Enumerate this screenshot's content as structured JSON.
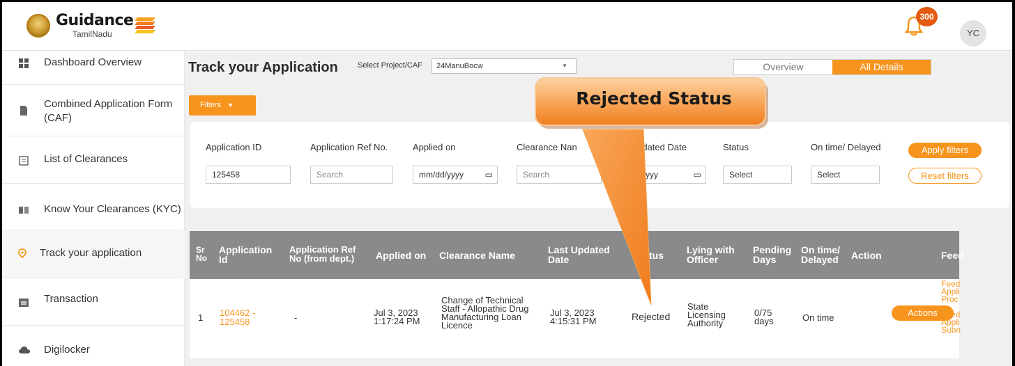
{
  "header": {
    "brand": "Guidance",
    "brand_sub": "TamilNadu",
    "notification_count": "300",
    "avatar_initials": "YC"
  },
  "sidebar": {
    "items": [
      {
        "label": "Dashboard Overview",
        "icon": "dashboard-icon"
      },
      {
        "label": "Combined Application Form (CAF)",
        "icon": "document-icon"
      },
      {
        "label": "List of Clearances",
        "icon": "list-icon"
      },
      {
        "label": "Know Your Clearances (KYC)",
        "icon": "book-icon"
      },
      {
        "label": "Track your application",
        "icon": "location-pin-icon"
      },
      {
        "label": "Transaction",
        "icon": "card-icon"
      },
      {
        "label": "Digilocker",
        "icon": "cloud-icon"
      }
    ]
  },
  "main": {
    "title": "Track your Application",
    "project_label": "Select Project/CAF",
    "project_value": "24ManuBocw",
    "tabs": [
      {
        "label": "Overview",
        "active": false
      },
      {
        "label": "All Details",
        "active": true
      }
    ],
    "filters_button": "Filters",
    "filters": {
      "application_id": {
        "label": "Application ID",
        "value": "125458"
      },
      "ref_no": {
        "label": "Application Ref No.",
        "placeholder": "Search"
      },
      "applied_on": {
        "label": "Applied on",
        "placeholder": "mm/dd/yyyy"
      },
      "clearance_name": {
        "label": "Clearance Nan",
        "placeholder": "Search"
      },
      "last_updated": {
        "label": "st Updated Date",
        "placeholder": "/dd/yyyy"
      },
      "status": {
        "label": "Status",
        "placeholder": "Select"
      },
      "on_time": {
        "label": "On time/ Delayed",
        "placeholder": "Select"
      }
    },
    "apply_filters": "Apply filters",
    "reset_filters": "Reset filters"
  },
  "table": {
    "headers": [
      "Sr No",
      "Application Id",
      "Application Ref No (from dept.)",
      "Applied on",
      "Clearance Name",
      "Last Updated Date",
      "tus",
      "Lying with Officer",
      "Pending Days",
      "On time/ Delayed",
      "Action",
      "Feed"
    ],
    "row": {
      "sr_no": "1",
      "app_id_1": "104462 -",
      "app_id_2": "125458",
      "ref_no": "-",
      "applied_date": "Jul 3, 2023",
      "applied_time": "1:17:24 PM",
      "clearance_1": "Change of Technical",
      "clearance_2": "Staff - Allopathic Drug",
      "clearance_3": "Manufacturing Loan",
      "clearance_4": "Licence",
      "updated_date": "Jul 3, 2023",
      "updated_time": "4:15:31 PM",
      "status": "Rejected",
      "officer_1": "State",
      "officer_2": "Licensing",
      "officer_3": "Authority",
      "pending_1": "0/75",
      "pending_2": "days",
      "on_time": "On time",
      "action_label": "Actions",
      "feed_1": "Feed",
      "feed_2": "Appli",
      "feed_3": "Proc",
      "feed_4": "Feed",
      "feed_5": "Appli",
      "feed_6": "Subn"
    }
  },
  "callout": {
    "text": "Rejected Status"
  },
  "colors": {
    "accent": "#f7941d",
    "table_header": "#8a8a8a",
    "badge": "#e35a10"
  }
}
